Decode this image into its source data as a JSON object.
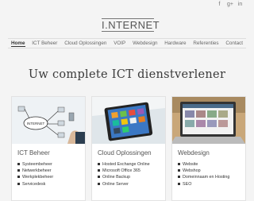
{
  "social": {
    "facebook_icon": "f",
    "googleplus_icon": "g+",
    "linkedin_icon": "in"
  },
  "brand": {
    "logo_text": "I.NTERNET"
  },
  "nav": {
    "items": [
      "Home",
      "ICT Beheer",
      "Cloud Oplossingen",
      "VOIP",
      "Webdesign",
      "Hardware",
      "Referenties",
      "Contact"
    ],
    "active": "Home"
  },
  "hero": {
    "title": "Uw complete ICT dienstverlener"
  },
  "cards": [
    {
      "title": "ICT Beheer",
      "image": "network-diagram-hand-drawing",
      "items": [
        "Systeembeheer",
        "Netwerkbeheer",
        "Werkplekbeheer",
        "Servicedesk"
      ]
    },
    {
      "title": "Cloud Oplossingen",
      "image": "tablet-with-apps",
      "items": [
        "Hosted Exchange Online",
        "Microsoft Office 365",
        "Online Backup",
        "Online Server"
      ]
    },
    {
      "title": "Webdesign",
      "image": "laptop-website",
      "items": [
        "Website",
        "Webshop",
        "Domeinnaam en Hosting",
        "SEO"
      ]
    }
  ]
}
